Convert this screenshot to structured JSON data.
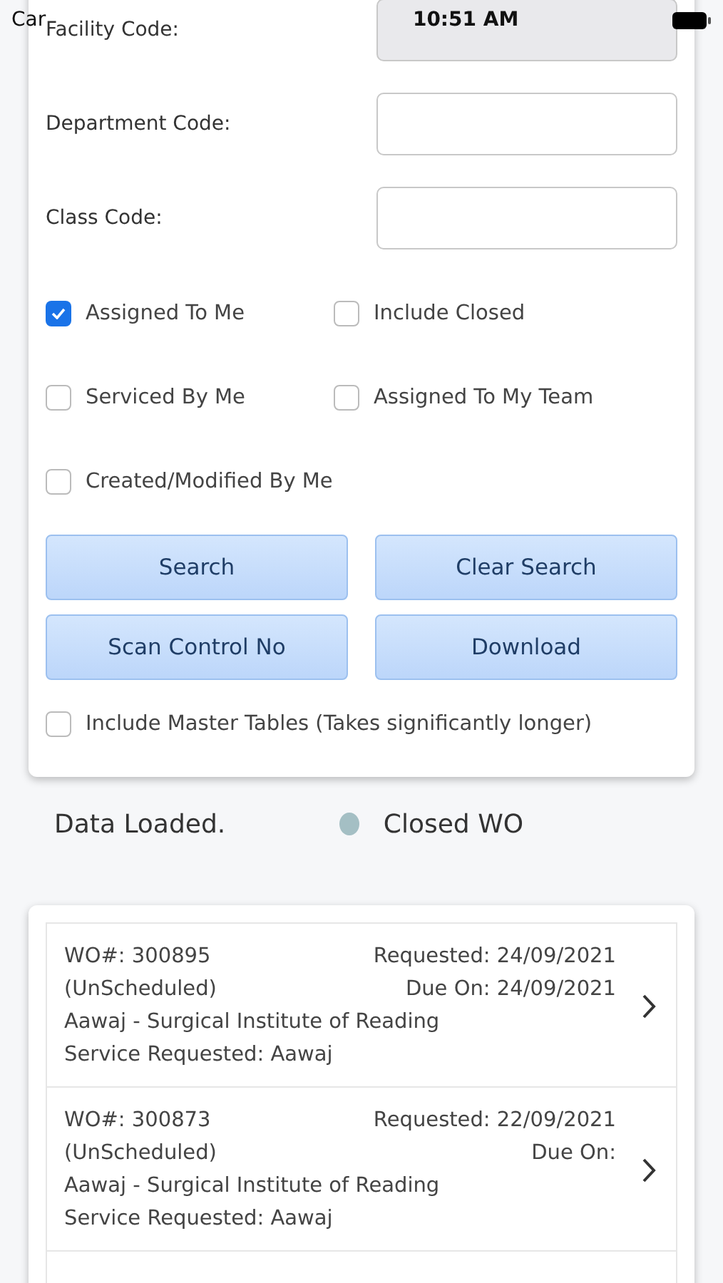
{
  "status_bar": {
    "carrier": "Car",
    "time": "10:51 AM"
  },
  "filters": {
    "fields": [
      {
        "label": "Facility Code:",
        "disabled": true
      },
      {
        "label": "Department Code:",
        "disabled": false
      },
      {
        "label": "Class Code:",
        "disabled": false
      }
    ],
    "checkboxes": [
      {
        "label": "Assigned To Me",
        "checked": true
      },
      {
        "label": "Include Closed",
        "checked": false
      },
      {
        "label": "Serviced By Me",
        "checked": false
      },
      {
        "label": "Assigned To My Team",
        "checked": false
      },
      {
        "label": "Created/Modified By Me",
        "checked": false
      }
    ],
    "buttons": [
      "Search",
      "Clear Search",
      "Scan Control No",
      "Download"
    ],
    "master_tables": {
      "label": "Include Master Tables (Takes significantly longer)",
      "checked": false
    }
  },
  "status": {
    "message": "Data Loaded.",
    "legend": {
      "label": "Closed WO",
      "color": "#a4bfc4"
    }
  },
  "work_orders": [
    {
      "number": "WO#: 300895",
      "type": "(UnScheduled)",
      "requested": "Requested: 24/09/2021",
      "due": "Due On: 24/09/2021",
      "site": "Aawaj - Surgical Institute of Reading",
      "service": "Service Requested: Aawaj"
    },
    {
      "number": "WO#: 300873",
      "type": "(UnScheduled)",
      "requested": "Requested: 22/09/2021",
      "due": "Due On:",
      "site": "Aawaj - Surgical Institute of Reading",
      "service": "Service Requested: Aawaj"
    }
  ]
}
